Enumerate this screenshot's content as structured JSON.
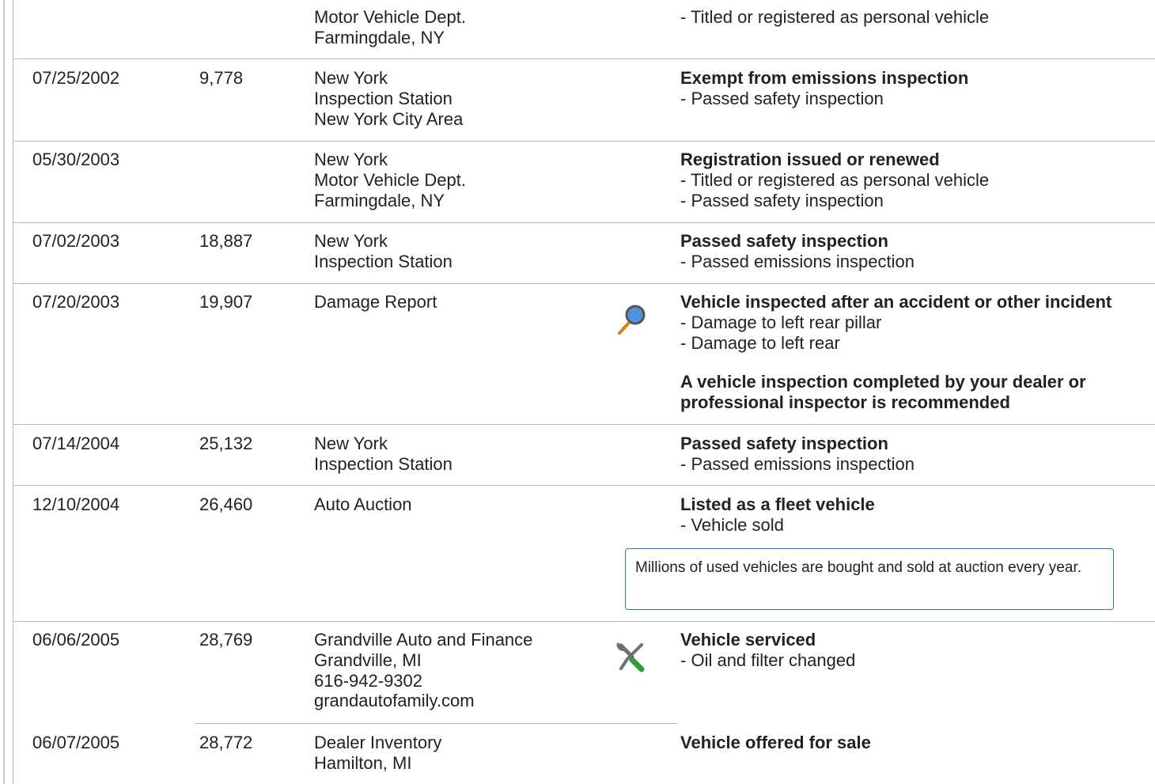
{
  "records": [
    {
      "date": "",
      "mileage": "",
      "source": [
        "Motor Vehicle Dept.",
        "Farmingdale, NY"
      ],
      "headline": "",
      "items": [
        "Titled or registered as personal vehicle"
      ],
      "icon": ""
    },
    {
      "date": "07/25/2002",
      "mileage": "9,778",
      "source": [
        "New York",
        "Inspection Station",
        "New York City Area"
      ],
      "headline": "Exempt from emissions inspection",
      "items": [
        "Passed safety inspection"
      ],
      "icon": ""
    },
    {
      "date": "05/30/2003",
      "mileage": "",
      "source": [
        "New York",
        "Motor Vehicle Dept.",
        "Farmingdale, NY"
      ],
      "headline": "Registration issued or renewed",
      "items": [
        "Titled or registered as personal vehicle",
        "Passed safety inspection"
      ],
      "icon": ""
    },
    {
      "date": "07/02/2003",
      "mileage": "18,887",
      "source": [
        "New York",
        "Inspection Station"
      ],
      "headline": "Passed safety inspection",
      "items": [
        "Passed emissions inspection"
      ],
      "icon": ""
    },
    {
      "date": "07/20/2003",
      "mileage": "19,907",
      "source": [
        "Damage Report"
      ],
      "headline": "Vehicle inspected after an accident or other incident",
      "items": [
        "Damage to left rear pillar",
        "Damage to left rear"
      ],
      "note": "A vehicle inspection completed by your dealer or professional inspector is recommended",
      "icon": "magnifier-icon"
    },
    {
      "date": "07/14/2004",
      "mileage": "25,132",
      "source": [
        "New York",
        "Inspection Station"
      ],
      "headline": "Passed safety inspection",
      "items": [
        "Passed emissions inspection"
      ],
      "icon": ""
    },
    {
      "date": "12/10/2004",
      "mileage": "26,460",
      "source": [
        "Auto Auction"
      ],
      "headline": "Listed as a fleet vehicle",
      "items": [
        "Vehicle sold"
      ],
      "callout": "Millions of used vehicles are bought and sold at auction every year.",
      "icon": ""
    },
    {
      "date": "06/06/2005",
      "mileage": "28,769",
      "source": [
        "Grandville Auto and Finance",
        "Grandville, MI",
        "616-942-9302",
        "grandautofamily.com"
      ],
      "headline": "Vehicle serviced",
      "items": [
        "Oil and filter changed"
      ],
      "icon": "wrench-screwdriver-icon"
    },
    {
      "date": "06/07/2005",
      "mileage": "28,772",
      "source": [
        "Dealer Inventory",
        "Hamilton, MI"
      ],
      "headline": "Vehicle offered for sale",
      "items": [],
      "icon": ""
    }
  ],
  "item_prefix": "- ",
  "colors": {
    "rule": "#b8b8b8",
    "callout_border": "#2b6fc6",
    "magnifier_lens": "#4f93d8",
    "magnifier_handle": "#e07b13",
    "wrench": "#6f6f6f",
    "screwdriver": "#2f9a3a"
  }
}
